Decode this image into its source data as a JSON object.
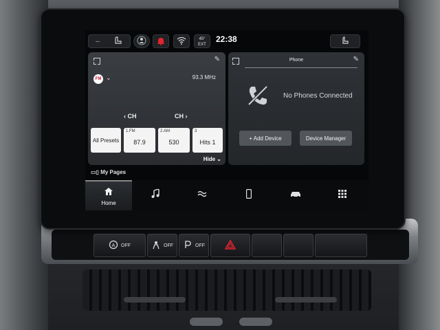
{
  "status_bar": {
    "dash_label": "--",
    "temp_value": "45°",
    "temp_label": "EXT",
    "time": "22:38"
  },
  "radio": {
    "band": "FM",
    "frequency": "93.3 MHz",
    "ch_prev": "CH",
    "ch_next": "CH",
    "all_presets": "All Presets",
    "presets": [
      {
        "slot": "1.FM",
        "value": "87.9"
      },
      {
        "slot": "2.AM",
        "value": "530"
      },
      {
        "slot": "3",
        "value": "Hits 1"
      }
    ],
    "hide_label": "Hide"
  },
  "phone": {
    "title": "Phone",
    "status": "No Phones Connected",
    "add_device": "+ Add Device",
    "device_manager": "Device Manager"
  },
  "my_pages": "My Pages",
  "nav": {
    "home_label": "Home",
    "items": [
      "home-icon",
      "music-icon",
      "climate-icon",
      "phone-icon",
      "vehicle-icon",
      "apps-icon"
    ]
  },
  "hardware_buttons": {
    "off_1": "OFF",
    "off_2": "OFF",
    "off_3": "OFF"
  },
  "colors": {
    "hazard": "#e0242e",
    "radio_badge": "#c8102e"
  }
}
